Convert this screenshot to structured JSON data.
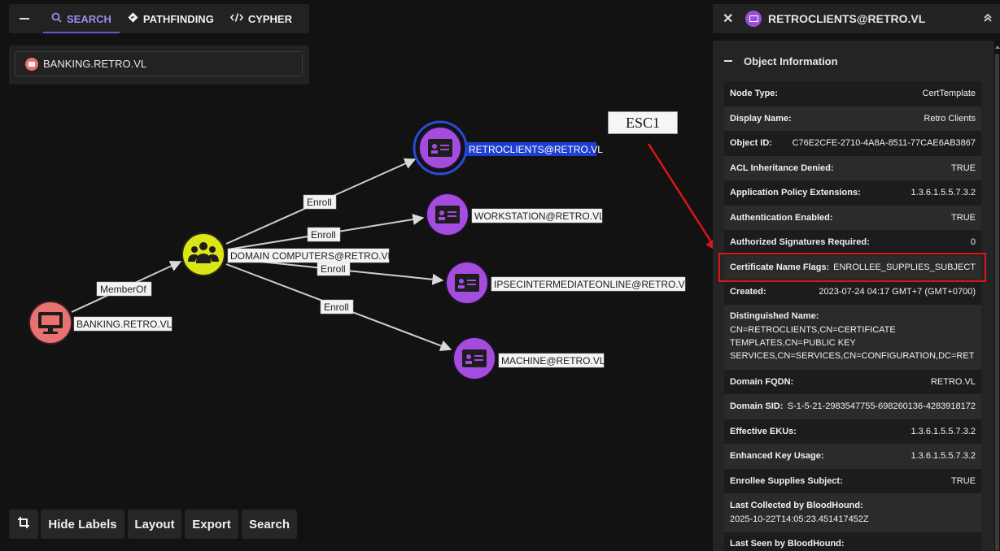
{
  "search_bar": {
    "tabs": [
      {
        "label": "SEARCH",
        "icon": "magnifier-icon",
        "active": true
      },
      {
        "label": "PATHFINDING",
        "icon": "diamond-route-icon",
        "active": false
      },
      {
        "label": "CYPHER",
        "icon": "code-icon",
        "active": false
      }
    ],
    "query": "BANKING.RETRO.VL"
  },
  "graph": {
    "nodes": [
      {
        "id": "banking",
        "label": "BANKING.RETRO.VL",
        "kind": "Computer",
        "color": "#e8726f",
        "icon": "monitor-icon",
        "selected": false
      },
      {
        "id": "domain-computers",
        "label": "DOMAIN COMPUTERS@RETRO.VL",
        "kind": "Group",
        "color": "#dbe617",
        "icon": "users-icon",
        "selected": false
      },
      {
        "id": "retroclients",
        "label": "RETROCLIENTS@RETRO.VL",
        "kind": "CertTemplate",
        "color": "#a44cdd",
        "icon": "id-card-icon",
        "selected": true
      },
      {
        "id": "workstation",
        "label": "WORKSTATION@RETRO.VL",
        "kind": "CertTemplate",
        "color": "#a44cdd",
        "icon": "id-card-icon",
        "selected": false
      },
      {
        "id": "ipsec",
        "label": "IPSECINTERMEDIATEONLINE@RETRO.VL",
        "kind": "CertTemplate",
        "color": "#a44cdd",
        "icon": "id-card-icon",
        "selected": false
      },
      {
        "id": "machine",
        "label": "MACHINE@RETRO.VL",
        "kind": "CertTemplate",
        "color": "#a44cdd",
        "icon": "id-card-icon",
        "selected": false
      }
    ],
    "edges": [
      {
        "from": "banking",
        "to": "domain-computers",
        "label": "MemberOf"
      },
      {
        "from": "domain-computers",
        "to": "retroclients",
        "label": "Enroll"
      },
      {
        "from": "domain-computers",
        "to": "workstation",
        "label": "Enroll"
      },
      {
        "from": "domain-computers",
        "to": "ipsec",
        "label": "Enroll"
      },
      {
        "from": "domain-computers",
        "to": "machine",
        "label": "Enroll"
      }
    ],
    "selection_color": "#2a4bd6"
  },
  "controls": {
    "crop_icon": "crop-icon",
    "hide_labels": "Hide Labels",
    "layout": "Layout",
    "export": "Export",
    "search": "Search"
  },
  "annotation": {
    "label": "ESC1",
    "color": "#e01414"
  },
  "panel": {
    "title": "RETROCLIENTS@RETRO.VL",
    "section": "Object Information",
    "rows": [
      {
        "key": "Node Type:",
        "value": "CertTemplate"
      },
      {
        "key": "Display Name:",
        "value": "Retro Clients"
      },
      {
        "key": "Object ID:",
        "value": "C76E2CFE-2710-4A8A-8511-77CAE6AB3867"
      },
      {
        "key": "ACL Inheritance Denied:",
        "value": "TRUE"
      },
      {
        "key": "Application Policy Extensions:",
        "value": "1.3.6.1.5.5.7.3.2"
      },
      {
        "key": "Authentication Enabled:",
        "value": "TRUE"
      },
      {
        "key": "Authorized Signatures Required:",
        "value": "0"
      },
      {
        "key": "Certificate Name Flags:",
        "value": "ENROLLEE_SUPPLIES_SUBJECT"
      },
      {
        "key": "Created:",
        "value": "2023-07-24 04:17 GMT+7 (GMT+0700)"
      },
      {
        "key": "Distinguished Name:",
        "value": "CN=RETROCLIENTS,CN=CERTIFICATE TEMPLATES,CN=PUBLIC KEY SERVICES,CN=SERVICES,CN=CONFIGURATION,DC=RETRO,…"
      },
      {
        "key": "Domain FQDN:",
        "value": "RETRO.VL"
      },
      {
        "key": "Domain SID:",
        "value": "S-1-5-21-2983547755-698260136-4283918172"
      },
      {
        "key": "Effective EKUs:",
        "value": "1.3.6.1.5.5.7.3.2"
      },
      {
        "key": "Enhanced Key Usage:",
        "value": "1.3.6.1.5.5.7.3.2"
      },
      {
        "key": "Enrollee Supplies Subject:",
        "value": "TRUE"
      },
      {
        "key": "Last Collected by BloodHound:",
        "value": "2025-10-22T14:05:23.451417452Z"
      },
      {
        "key": "Last Seen by BloodHound:",
        "value": ""
      }
    ]
  }
}
